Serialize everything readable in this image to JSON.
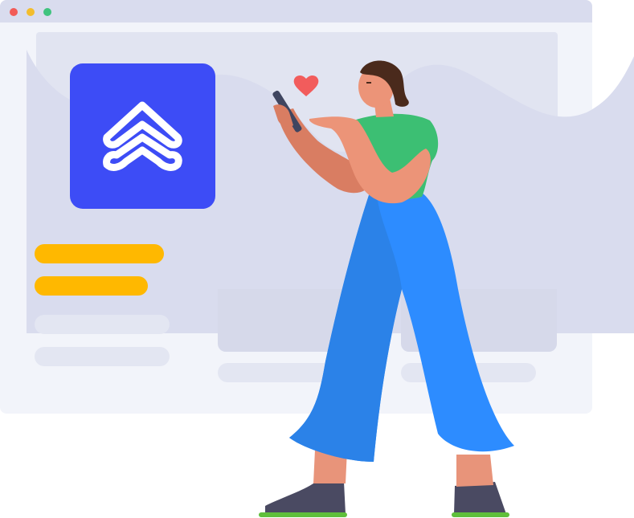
{
  "illustration": {
    "browser_window": {
      "controls": [
        "close",
        "minimize",
        "maximize"
      ]
    },
    "logo": {
      "icon": "double-chevron-up-icon",
      "tile_color": "#3d4cf6"
    },
    "placeholder_bars": {
      "highlight_color": "#ffb800",
      "muted_color": "#e3e6f2"
    },
    "person": {
      "holding": "phone-icon",
      "reaction": "heart-icon",
      "heart_color": "#f25c5c",
      "shirt_color": "#3cbf73",
      "pants_color": "#2d8cff"
    }
  }
}
